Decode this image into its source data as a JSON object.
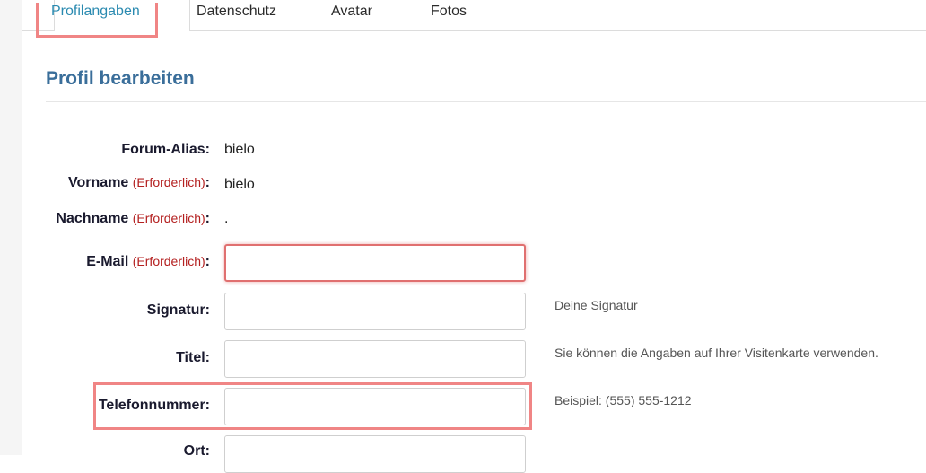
{
  "tabs": [
    {
      "label": "Profilangaben",
      "active": true
    },
    {
      "label": "Datenschutz",
      "active": false
    },
    {
      "label": "Avatar",
      "active": false
    },
    {
      "label": "Fotos",
      "active": false
    }
  ],
  "page_title": "Profil bearbeiten",
  "fields": {
    "forum_alias": {
      "label": "Forum-Alias",
      "value": "bielo"
    },
    "vorname": {
      "label": "Vorname",
      "required": "(Erforderlich)",
      "value": "bielo"
    },
    "nachname": {
      "label": "Nachname",
      "required": "(Erforderlich)",
      "value": "."
    },
    "email": {
      "label": "E-Mail",
      "required": "(Erforderlich)",
      "value": ""
    },
    "signatur": {
      "label": "Signatur",
      "value": "",
      "hint": "Deine Signatur"
    },
    "titel": {
      "label": "Titel",
      "value": "",
      "hint": "Sie können die Angaben auf Ihrer Visitenkarte verwenden."
    },
    "telefonnummer": {
      "label": "Telefonnummer",
      "value": "",
      "hint": "Beispiel: (555) 555-1212"
    },
    "ort": {
      "label": "Ort",
      "value": ""
    }
  },
  "colon": ":",
  "colors": {
    "accent": "#3a6e9a",
    "active_tab": "#2a8ab0",
    "required": "#b42020",
    "highlight": "#f08585"
  }
}
